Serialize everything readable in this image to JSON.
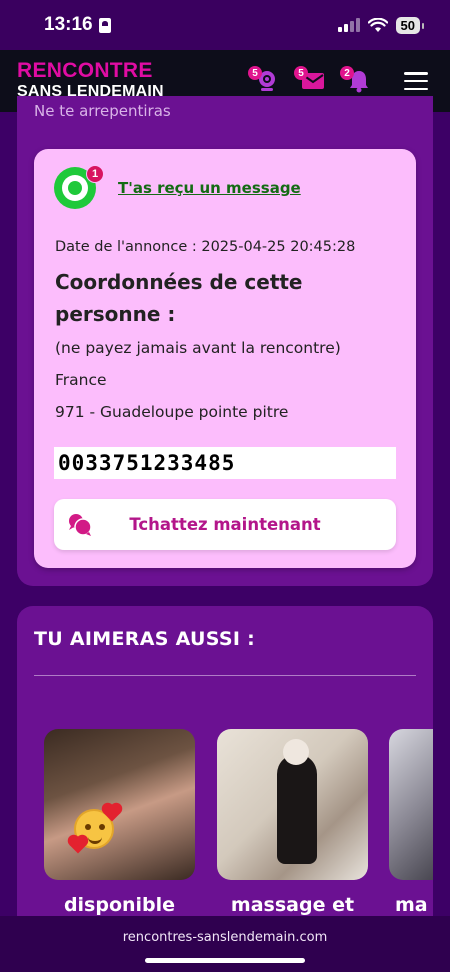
{
  "status_bar": {
    "time": "13:16",
    "battery": "50"
  },
  "header": {
    "logo_line1": "RENCONTRE",
    "logo_line2": "SANS LENDEMAIN",
    "webcam_badge": "5",
    "mail_badge": "5",
    "notif_badge": "2"
  },
  "panel": {
    "cut_text": "Ne te arrepentiras"
  },
  "card": {
    "message_badge": "1",
    "message_link": "T'as reçu un message",
    "date_line": "Date de l'annonce : 2025-04-25 20:45:28",
    "title": "Coordonnées de cette personne :",
    "note": "(ne payez jamais avant la rencontre)",
    "country": "France",
    "region": "971 - Guadeloupe pointe pitre",
    "phone": "0033751233485",
    "chat_button": "Tchattez maintenant"
  },
  "also_like": {
    "title": "TU AIMERAS AUSSI :",
    "items": [
      {
        "caption": "disponible"
      },
      {
        "caption": "massage et"
      },
      {
        "caption": "ma"
      }
    ]
  },
  "browser": {
    "url": "rencontres-sanslendemain.com"
  },
  "colors": {
    "brand_pink": "#e00ca3",
    "panel_purple": "#6b1192",
    "card_pink": "#fcbdfc",
    "link_green": "#146b14"
  }
}
